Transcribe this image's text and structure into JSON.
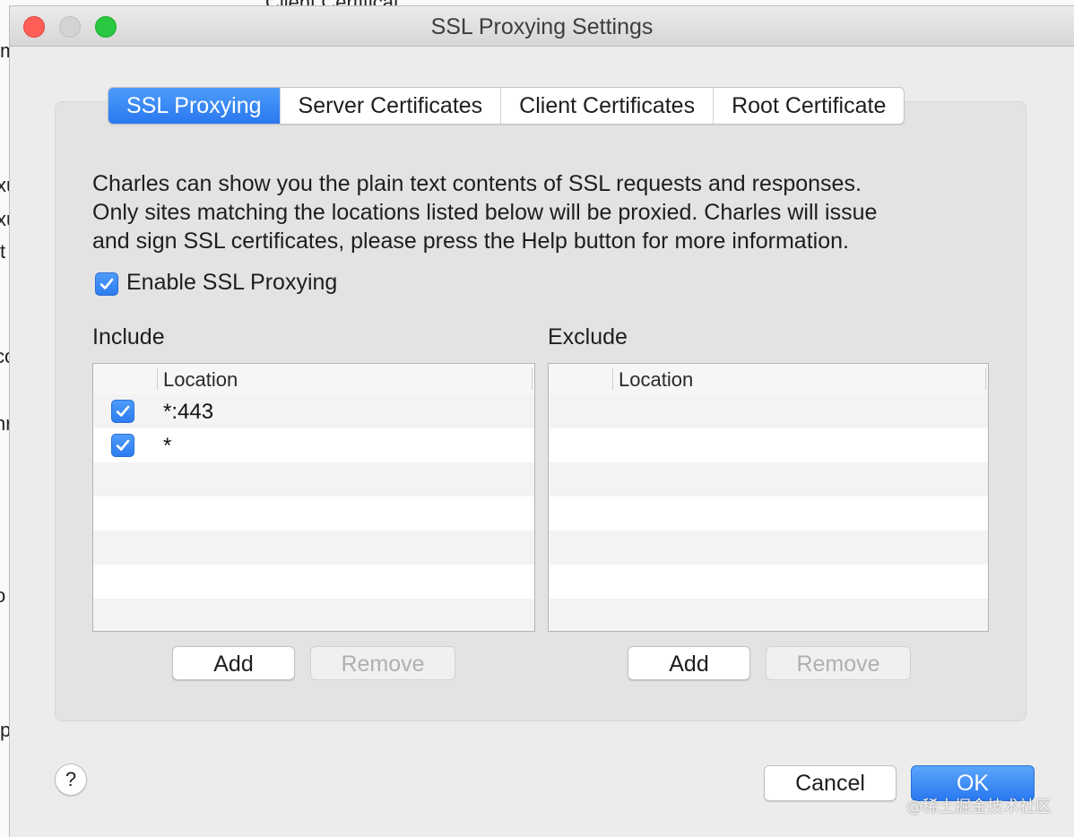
{
  "window": {
    "title": "SSL Proxying Settings"
  },
  "background_fragments": [
    "Client Certificat",
    "m",
    "xu",
    "xu",
    "t",
    "co",
    "nr",
    "o",
    "p"
  ],
  "tabs": [
    {
      "label": "SSL Proxying",
      "active": true
    },
    {
      "label": "Server Certificates",
      "active": false
    },
    {
      "label": "Client Certificates",
      "active": false
    },
    {
      "label": "Root Certificate",
      "active": false
    }
  ],
  "description": [
    "Charles can show you the plain text contents of SSL requests and responses.",
    "Only sites matching the locations listed below will be proxied. Charles will issue",
    "and sign SSL certificates, please press the Help button for more information."
  ],
  "enable_ssl": {
    "label": "Enable SSL Proxying",
    "checked": true
  },
  "include": {
    "label": "Include",
    "column_header": "Location",
    "rows": [
      {
        "location": "*:443",
        "checked": true
      },
      {
        "location": "*",
        "checked": true
      }
    ],
    "add_label": "Add",
    "remove_label": "Remove"
  },
  "exclude": {
    "label": "Exclude",
    "column_header": "Location",
    "rows": [],
    "add_label": "Add",
    "remove_label": "Remove"
  },
  "footer": {
    "help_label": "?",
    "cancel_label": "Cancel",
    "ok_label": "OK"
  },
  "watermark": "@稀土掘金技术社区",
  "colors": {
    "accent": "#2a78f0",
    "close": "#ff5f57",
    "maximize": "#28c840"
  }
}
